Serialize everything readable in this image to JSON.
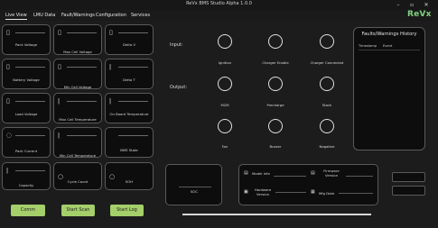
{
  "window": {
    "title": "ReVx BMS Studio Alpha 1.0.0",
    "minimize": "–",
    "maximize": "▫",
    "close": "✕"
  },
  "menu": {
    "items": [
      "Live View",
      "LMU Data",
      "Fault/Warnings",
      "Configuration",
      "Services"
    ],
    "active": "Live View"
  },
  "logo": {
    "text": "ReVx",
    "color": "#7fd37f"
  },
  "cards": [
    {
      "label": "Pack Voltage",
      "icon": "battery-icon"
    },
    {
      "label": "Max Cell Voltage",
      "icon": "battery-icon"
    },
    {
      "label": "Delta V",
      "icon": "battery-icon"
    },
    {
      "label": "Battery Voltage",
      "icon": "battery-icon"
    },
    {
      "label": "Min Cell Voltage",
      "icon": "battery-icon"
    },
    {
      "label": "Delta T",
      "icon": "thermometer-icon"
    },
    {
      "label": "Load Voltage",
      "icon": "battery-icon"
    },
    {
      "label": "Max Cell Temperature",
      "icon": "thermometer-icon"
    },
    {
      "label": "On Board Temperature",
      "icon": "thermometer-icon"
    },
    {
      "label": "Pack Current",
      "icon": "current-icon"
    },
    {
      "label": "Min Cell Temperature",
      "icon": "thermometer-icon"
    },
    {
      "label": "BMS State",
      "icon": "state-icon"
    },
    {
      "label": "Capacity",
      "icon": "capacity-icon"
    },
    {
      "label": "Cycle Count",
      "icon": "cycle-icon"
    },
    {
      "label": "SOH",
      "icon": "soh-icon"
    }
  ],
  "io": {
    "input_label": "Input:",
    "output_label": "Output:",
    "inputs": [
      "Ignition",
      "Charger Enable",
      "Charger Connected"
    ],
    "outputs": [
      "M2M",
      "Precharge",
      "Stack"
    ],
    "extras": [
      "Fan",
      "Buzzer",
      "Negative"
    ]
  },
  "faults_panel": {
    "title": "Faults/Warnings History",
    "columns": [
      "Timestamp",
      "Event"
    ]
  },
  "soc": {
    "label": "SOC"
  },
  "info": {
    "model_info": "Model Info",
    "firmware_version": "Firmware Version",
    "hardware_version": "Hardware Version",
    "mfg_date": "Mfg Date"
  },
  "buttons": {
    "comm": "Comm",
    "start_scan": "Start Scan",
    "start_log": "Start Log"
  },
  "colors": {
    "background": "#1c1c1c",
    "button": "#a5cf6a",
    "card_border": "#5a5a5a"
  }
}
